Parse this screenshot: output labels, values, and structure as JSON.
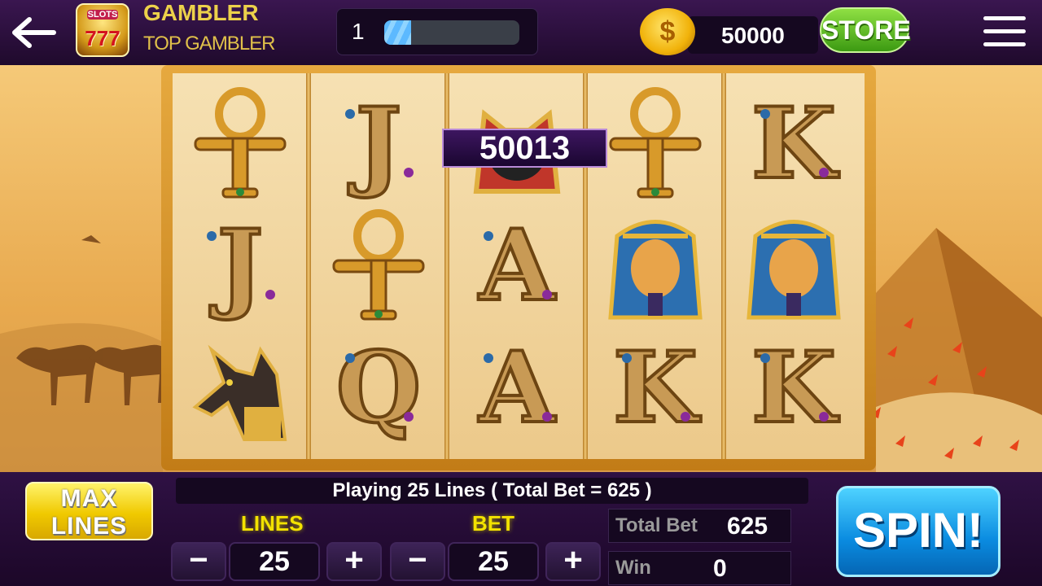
{
  "header": {
    "back_icon": "back-arrow-icon",
    "logo_text_top": "SLOTS",
    "logo_text_main": "777",
    "player_name": "GAMBLER",
    "player_rank": "TOP GAMBLER",
    "level": "1",
    "level_progress": 0.2,
    "coins": "50000",
    "coin_icon": "dollar-coin-icon",
    "coin_symbol": "$",
    "store_label": "STORE",
    "menu_icon": "hamburger-menu-icon"
  },
  "reels": {
    "win_amount": "50013",
    "columns": [
      [
        "ankh",
        "J",
        "anubis"
      ],
      [
        "J",
        "ankh",
        "Q"
      ],
      [
        "bastet-cat",
        "A",
        "A"
      ],
      [
        "ankh",
        "pharaoh",
        "K"
      ],
      [
        "K",
        "pharaoh",
        "K"
      ]
    ]
  },
  "controls": {
    "max_lines_line1": "MAX",
    "max_lines_line2": "LINES",
    "status_text": "Playing 25 Lines ( Total Bet = 625 )",
    "lines_label": "LINES",
    "lines_value": "25",
    "bet_label": "BET",
    "bet_value": "25",
    "minus_symbol": "−",
    "plus_symbol": "+",
    "total_bet_label": "Total Bet",
    "total_bet_value": "625",
    "win_label": "Win",
    "win_value": "0",
    "spin_label": "SPIN!"
  },
  "colors": {
    "gold": "#ecd14a",
    "store_green": "#3c9a12",
    "spin_blue": "#0a8be0",
    "max_lines_yellow": "#f0c900"
  }
}
